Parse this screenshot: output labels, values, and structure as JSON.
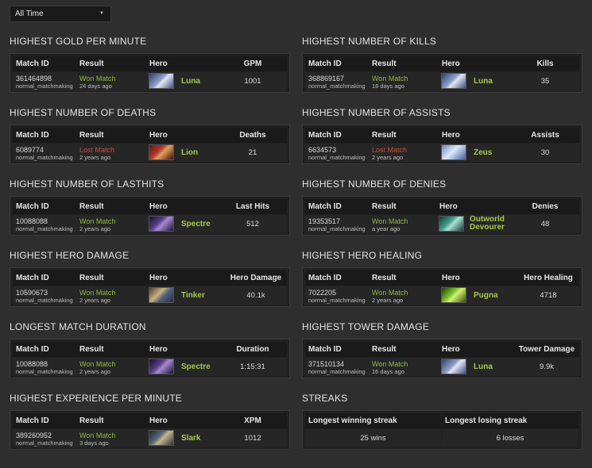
{
  "filter": {
    "selected": "All Time"
  },
  "headers": {
    "match_id": "Match ID",
    "result": "Result",
    "hero": "Hero"
  },
  "sections": {
    "gpm": {
      "title": "HIGHEST GOLD PER MINUTE",
      "stat_label": "GPM",
      "match_id": "361464898",
      "match_type": "normal_matchmaking",
      "result": "Won Match",
      "ago": "24 days ago",
      "hero": "Luna",
      "value": "1001"
    },
    "kills": {
      "title": "HIGHEST NUMBER OF KILLS",
      "stat_label": "Kills",
      "match_id": "368869167",
      "match_type": "normal_matchmaking",
      "result": "Won Match",
      "ago": "18 days ago",
      "hero": "Luna",
      "value": "35"
    },
    "deaths": {
      "title": "HIGHEST NUMBER OF DEATHS",
      "stat_label": "Deaths",
      "match_id": "6089774",
      "match_type": "normal_matchmaking",
      "result": "Lost Match",
      "ago": "2 years ago",
      "hero": "Lion",
      "value": "21"
    },
    "assists": {
      "title": "HIGHEST NUMBER OF ASSISTS",
      "stat_label": "Assists",
      "match_id": "6634573",
      "match_type": "normal_matchmaking",
      "result": "Lost Match",
      "ago": "2 years ago",
      "hero": "Zeus",
      "value": "30"
    },
    "lasthits": {
      "title": "HIGHEST NUMBER OF LASTHITS",
      "stat_label": "Last Hits",
      "match_id": "10088088",
      "match_type": "normal_matchmaking",
      "result": "Won Match",
      "ago": "2 years ago",
      "hero": "Spectre",
      "value": "512"
    },
    "denies": {
      "title": "HIGHEST NUMBER OF DENIES",
      "stat_label": "Denies",
      "match_id": "19353517",
      "match_type": "normal_matchmaking",
      "result": "Won Match",
      "ago": "a year ago",
      "hero_line1": "Outworld",
      "hero_line2": "Devourer",
      "value": "48"
    },
    "herodamage": {
      "title": "HIGHEST HERO DAMAGE",
      "stat_label": "Hero Damage",
      "match_id": "10590673",
      "match_type": "normal_matchmaking",
      "result": "Won Match",
      "ago": "2 years ago",
      "hero": "Tinker",
      "value": "40.1k"
    },
    "herohealing": {
      "title": "HIGHEST HERO HEALING",
      "stat_label": "Hero Healing",
      "match_id": "7022205",
      "match_type": "normal_matchmaking",
      "result": "Won Match",
      "ago": "2 years ago",
      "hero": "Pugna",
      "value": "4718"
    },
    "duration": {
      "title": "LONGEST MATCH DURATION",
      "stat_label": "Duration",
      "match_id": "10088088",
      "match_type": "normal_matchmaking",
      "result": "Won Match",
      "ago": "2 years ago",
      "hero": "Spectre",
      "value": "1:15:31"
    },
    "towerdamage": {
      "title": "HIGHEST TOWER DAMAGE",
      "stat_label": "Tower Damage",
      "match_id": "371510134",
      "match_type": "normal_matchmaking",
      "result": "Won Match",
      "ago": "16 days ago",
      "hero": "Luna",
      "value": "9.9k"
    },
    "xpm": {
      "title": "HIGHEST EXPERIENCE PER MINUTE",
      "stat_label": "XPM",
      "match_id": "389260952",
      "match_type": "normal_matchmaking",
      "result": "Won Match",
      "ago": "3 days ago",
      "hero": "Slark",
      "value": "1012"
    }
  },
  "streaks": {
    "title": "STREAKS",
    "winning_label": "Longest winning streak",
    "winning_value": "25 wins",
    "losing_label": "Longest losing streak",
    "losing_value": "6 losses"
  },
  "colors": {
    "won": "#92b83f",
    "lost": "#d24a3a",
    "hero_name": "#a6c94a"
  }
}
